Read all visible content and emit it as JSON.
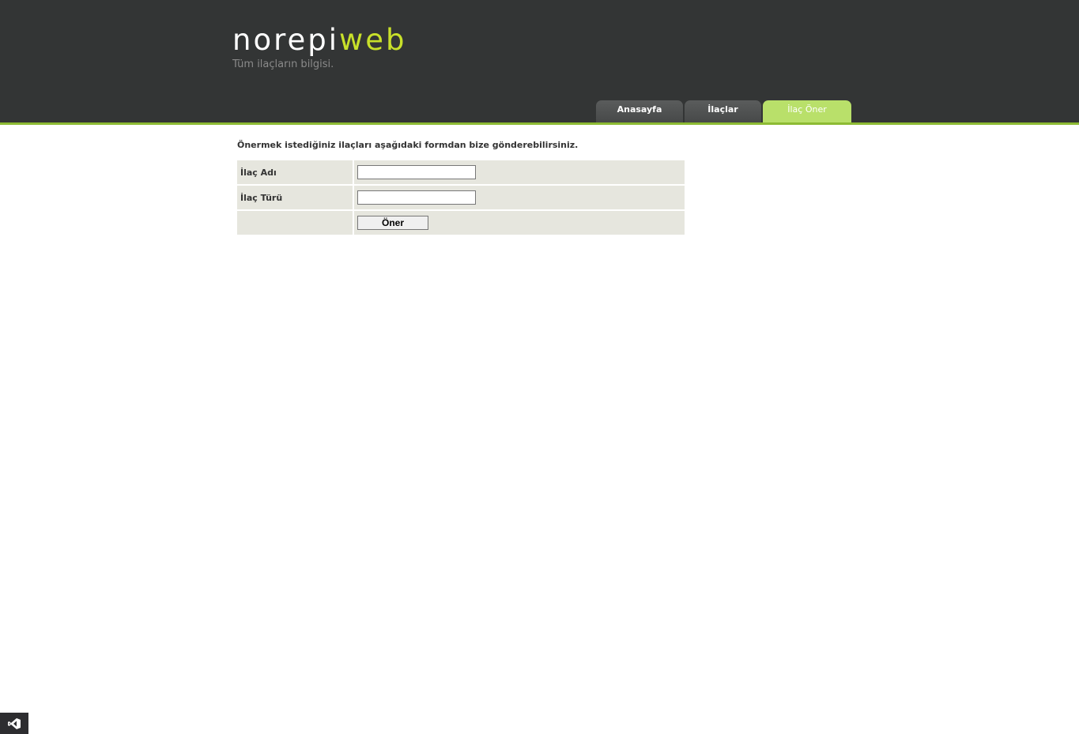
{
  "site": {
    "logo_part1": "norepi",
    "logo_part2": "web",
    "tagline": "Tüm ilaçların bilgisi."
  },
  "nav": {
    "tabs": [
      {
        "label": "Anasayfa",
        "active": false
      },
      {
        "label": "İlaçlar",
        "active": false
      },
      {
        "label": "İlaç Öner",
        "active": true
      }
    ]
  },
  "main": {
    "intro": "Önermek istediğiniz ilaçları aşağıdaki formdan bize gönderebilirsiniz.",
    "form": {
      "name_label": "İlaç Adı",
      "name_value": "",
      "type_label": "İlaç Türü",
      "type_value": "",
      "submit_label": "Öner"
    }
  },
  "colors": {
    "header_bg": "#333535",
    "accent_yellow": "#c8e02a",
    "accent_green": "#8dbb33",
    "active_tab": "#b9e06a",
    "form_row_bg": "#e6e6de"
  },
  "icons": {
    "corner_badge": "visual-studio-icon"
  }
}
